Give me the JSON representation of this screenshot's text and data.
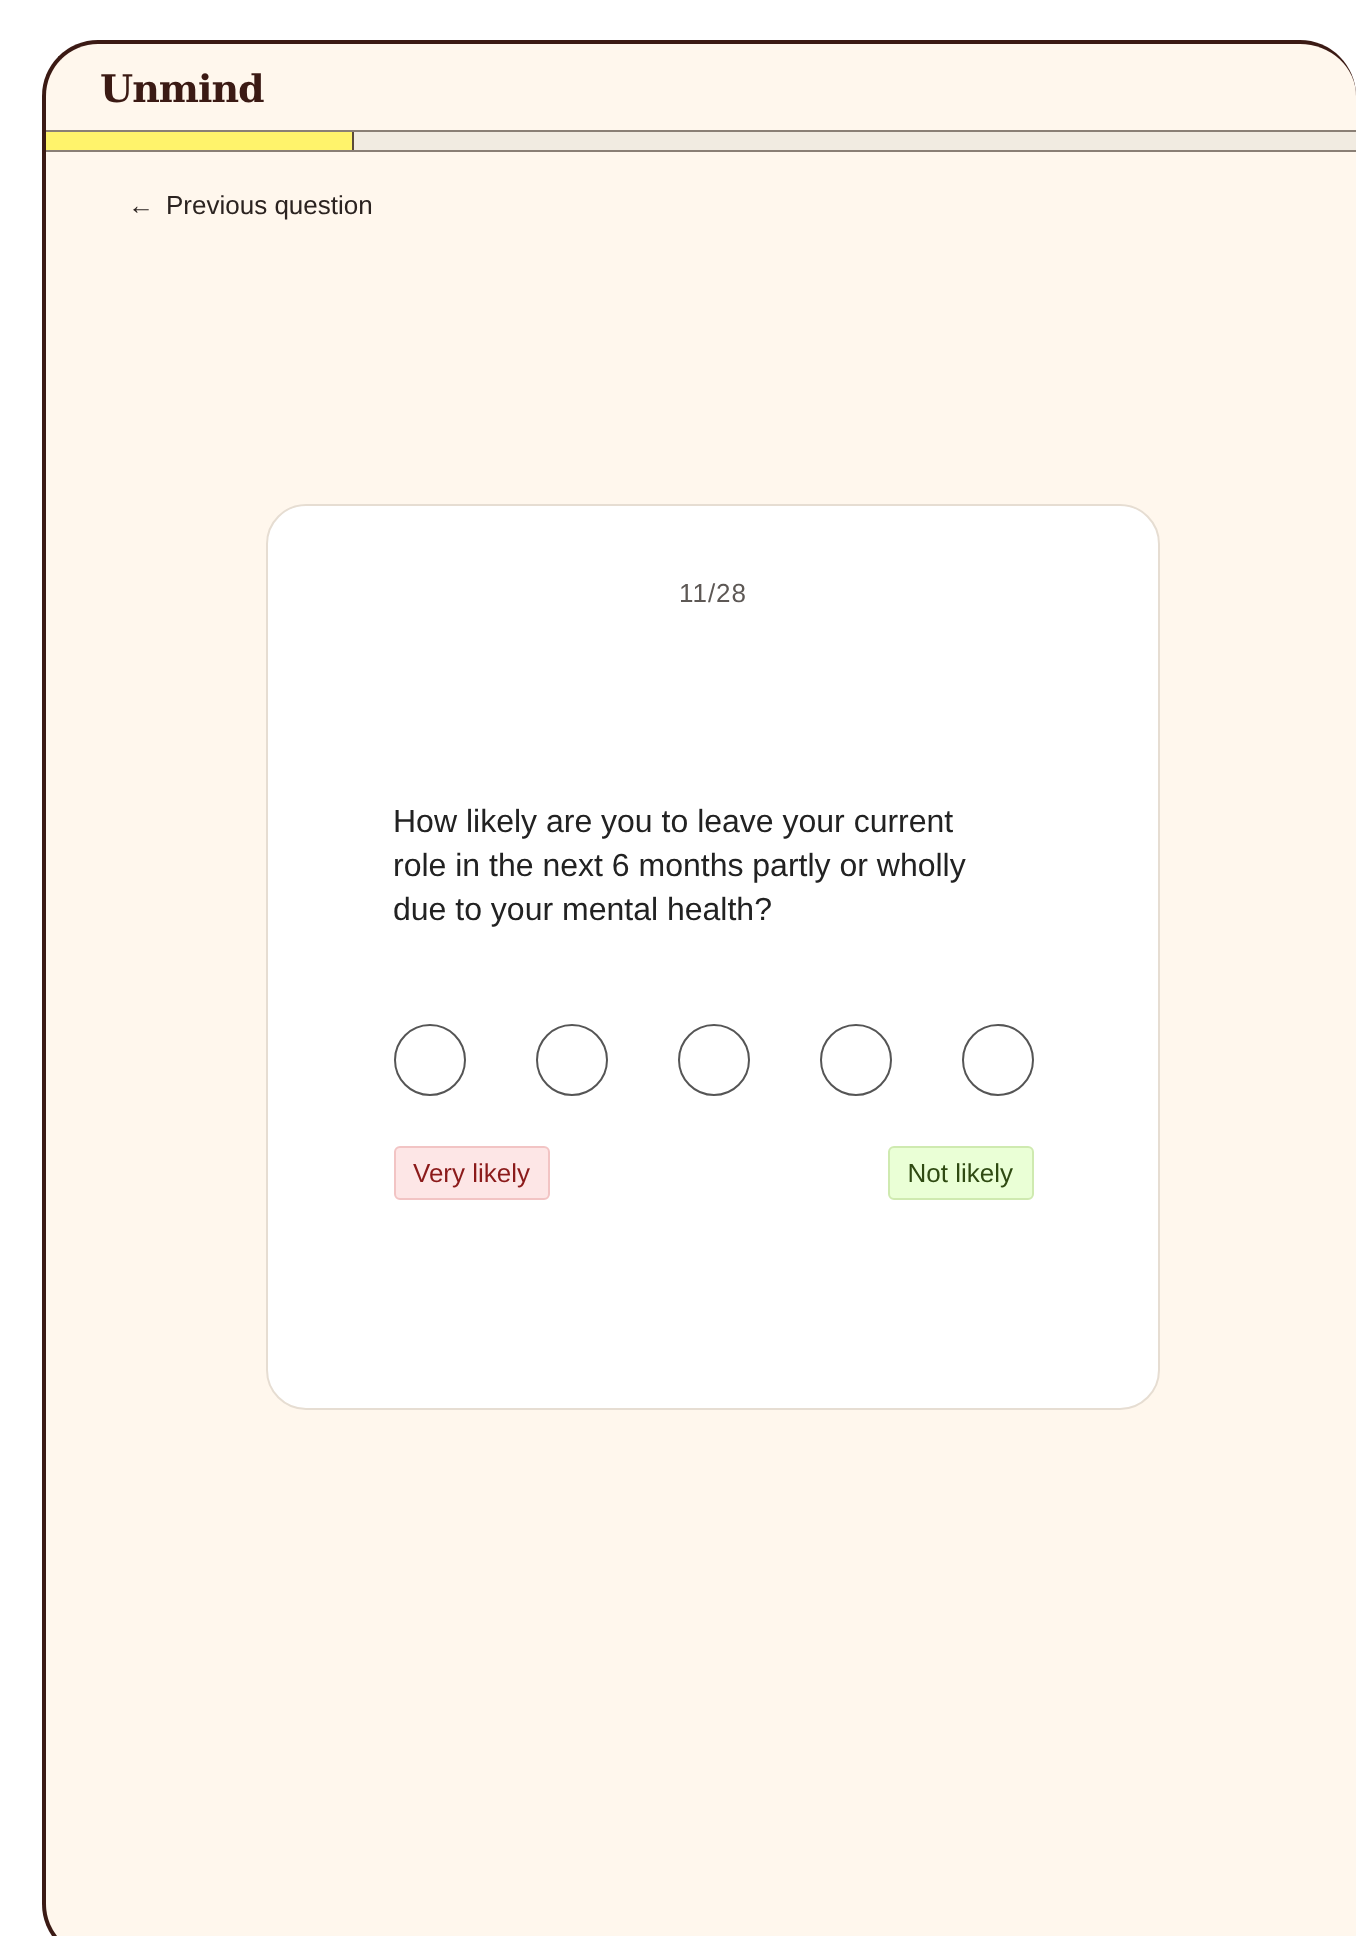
{
  "logo": "Unmind",
  "progress": {
    "level": 0.235
  },
  "back_link": {
    "arrow": "←",
    "label": "Previous question"
  },
  "card": {
    "counter": "11/28",
    "question": "How likely are you to leave your current role in the next 6 months partly or wholly due to your mental health?",
    "options": [
      {
        "selected": false
      },
      {
        "selected": false
      },
      {
        "selected": false
      },
      {
        "selected": false
      },
      {
        "selected": false
      }
    ],
    "scale_labels": [
      {
        "text": "Very likely",
        "kind": "negative"
      },
      {
        "text": "Not likely",
        "kind": "positive"
      }
    ]
  }
}
